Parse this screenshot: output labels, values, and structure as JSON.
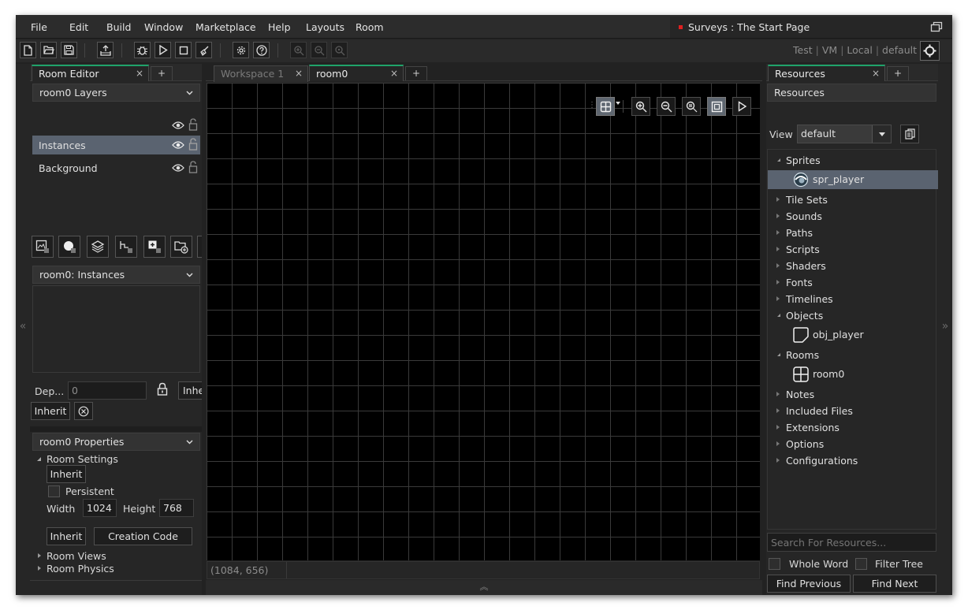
{
  "menu": [
    "File",
    "Edit",
    "Build",
    "Window",
    "Marketplace",
    "Help",
    "Layouts",
    "Room"
  ],
  "title": "Surveys : The Start Page",
  "toolbar": {
    "target": {
      "config": "Test",
      "device": "VM",
      "platform": "Local",
      "profile": "default"
    }
  },
  "left_panel": {
    "tab": {
      "label": "Room Editor",
      "close": "×"
    },
    "tab_add": "+",
    "layers_header": "room0 Layers",
    "layers": [
      "Instances",
      "Background"
    ],
    "instances_header": "room0: Instances",
    "depth_label": "Dep...",
    "depth_value": "0",
    "inherit_partial": "Inhe",
    "inherit_label": "Inherit",
    "properties_header": "room0 Properties",
    "room_settings": "Room Settings",
    "settings_inherit": "Inherit",
    "persistent_label": "Persistent",
    "width_label": "Width",
    "width_value": "1024",
    "height_label": "Height",
    "height_value": "768",
    "inherit2": "Inherit",
    "creation_code": "Creation Code",
    "room_views": "Room Views",
    "room_physics": "Room Physics"
  },
  "strip_left_arrow": "«",
  "strip_right_arrow": "»",
  "center": {
    "tabs": [
      {
        "label": "Workspace 1",
        "close": "×"
      },
      {
        "label": "room0",
        "close": "×"
      }
    ],
    "tab_add": "+",
    "coords": "(1084, 656)",
    "expand": "︽"
  },
  "right_panel": {
    "tab": {
      "label": "Resources",
      "close": "×"
    },
    "tab_add": "+",
    "header": "Resources",
    "view_label": "View",
    "view_value": "default",
    "tree": {
      "sprites": "Sprites",
      "spr_player": "spr_player",
      "tile_sets": "Tile Sets",
      "sounds": "Sounds",
      "paths": "Paths",
      "scripts": "Scripts",
      "shaders": "Shaders",
      "fonts": "Fonts",
      "timelines": "Timelines",
      "objects": "Objects",
      "obj_player": "obj_player",
      "rooms": "Rooms",
      "room0": "room0",
      "notes": "Notes",
      "included_files": "Included Files",
      "extensions": "Extensions",
      "options": "Options",
      "configurations": "Configurations"
    },
    "search_placeholder": "Search For Resources...",
    "whole_word": "Whole Word",
    "filter_tree": "Filter Tree",
    "find_previous": "Find Previous",
    "find_next": "Find Next"
  },
  "colors": {
    "accent": "#1fa36a",
    "selection": "#5a6370",
    "title_dot": "#e02020"
  }
}
